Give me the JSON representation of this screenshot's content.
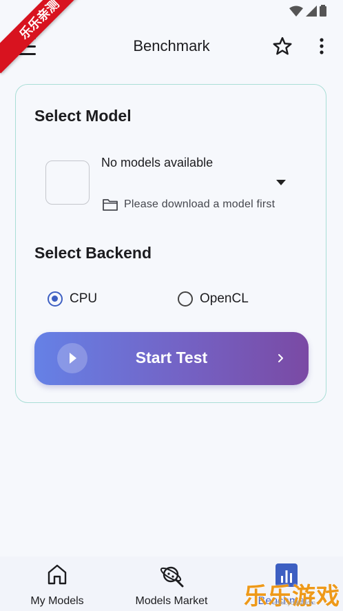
{
  "ribbon": "乐乐亲测",
  "app_bar": {
    "title": "Benchmark"
  },
  "select_model": {
    "title": "Select Model",
    "model_name": "No models available",
    "hint": "Please download a model first"
  },
  "select_backend": {
    "title": "Select Backend",
    "options": [
      {
        "label": "CPU",
        "selected": true
      },
      {
        "label": "OpenCL",
        "selected": false
      }
    ]
  },
  "start_button": {
    "label": "Start Test"
  },
  "bottom_nav": {
    "items": [
      {
        "label": "My Models",
        "icon": "home-icon"
      },
      {
        "label": "Models Market",
        "icon": "planet-search-icon"
      },
      {
        "label": "Benchmark",
        "icon": "chart-icon",
        "active": true
      }
    ]
  },
  "watermark": {
    "text": "乐乐游戏",
    "url": "www.youxi.com"
  },
  "colors": {
    "accent": "#3d5fc2",
    "card_border": "#a9ded6",
    "gradient_start": "#6581e6",
    "gradient_end": "#7a4aa4"
  }
}
